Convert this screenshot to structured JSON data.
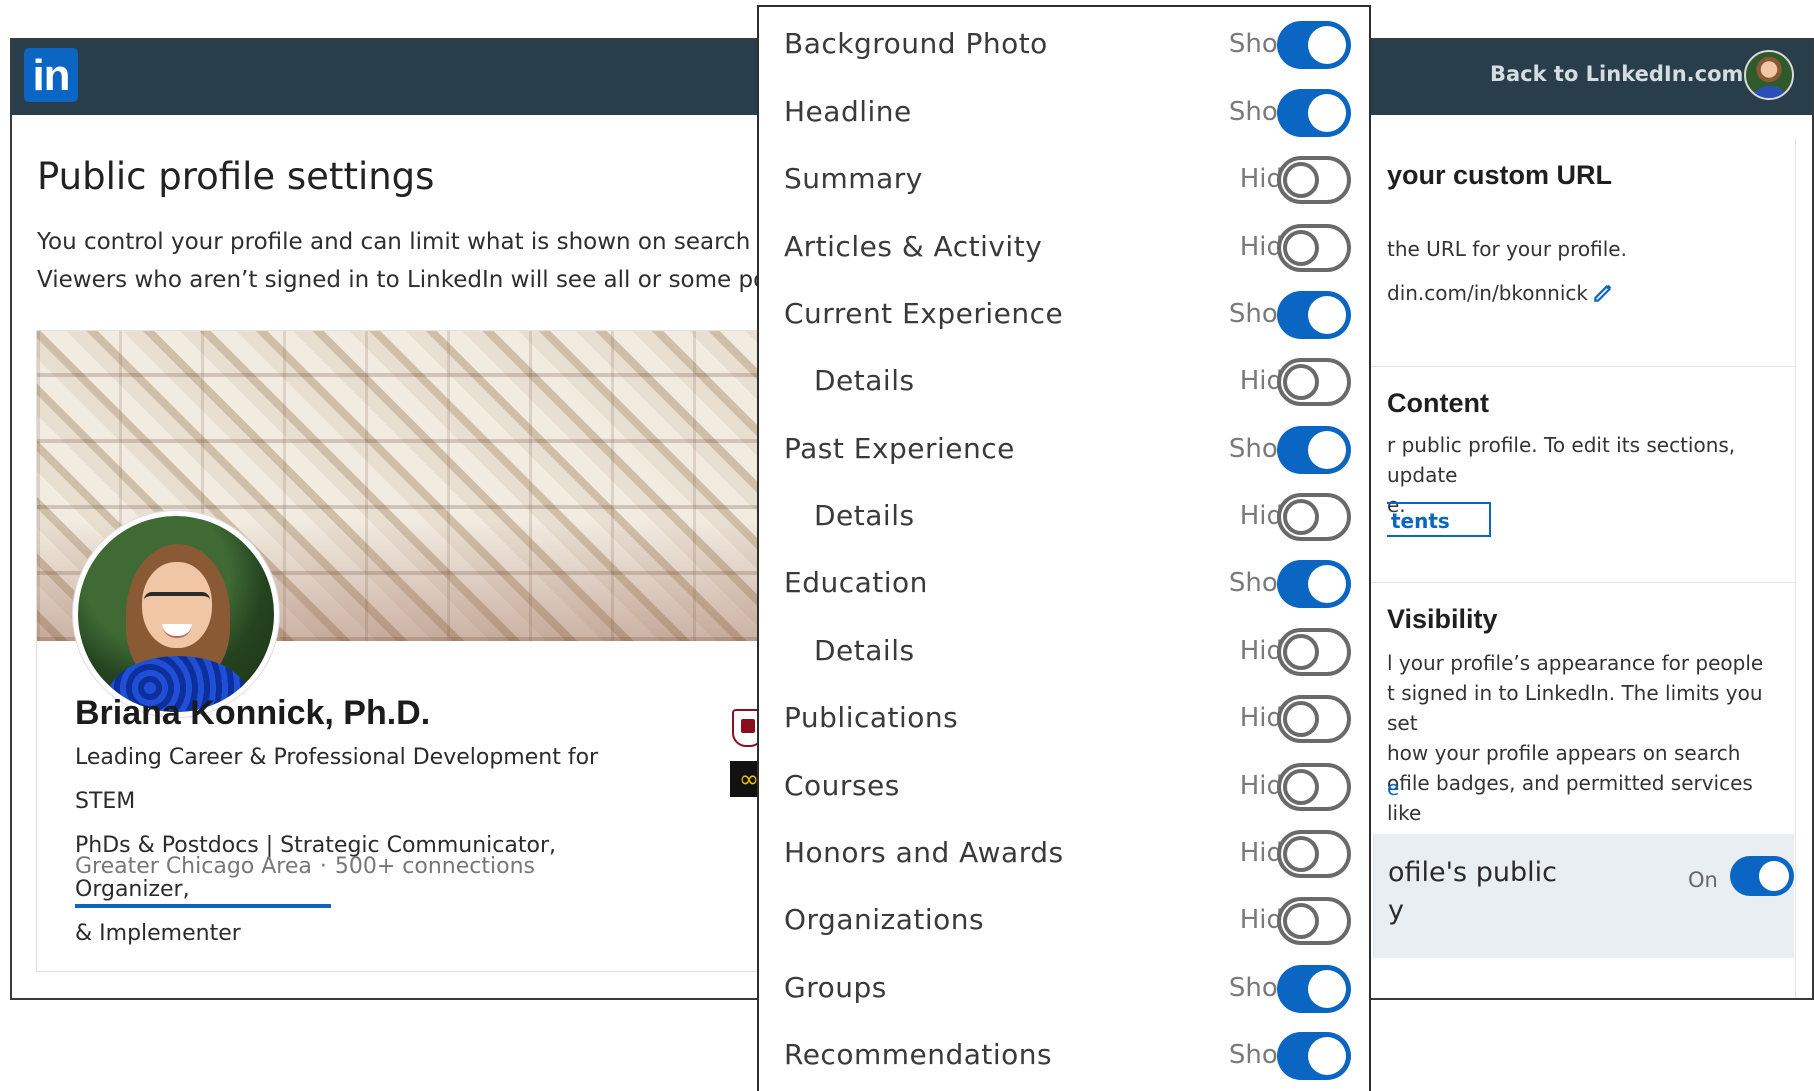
{
  "header": {
    "logo_text": "in",
    "back_link": "Back to LinkedIn.com"
  },
  "page": {
    "title": "Public profile settings",
    "intro_line1": "You control your profile and can limit what is shown on search en",
    "intro_line2": "Viewers who aren’t signed in to LinkedIn will see all or some porti"
  },
  "profile": {
    "name": "Briana Konnick, Ph.D.",
    "headline_line1": "Leading Career & Professional Development for STEM",
    "headline_line2": "PhDs & Postdocs | Strategic Communicator, Organizer,",
    "headline_line3": "& Implementer",
    "location": "Greater Chicago Area",
    "separator": "·",
    "connections": "500+ connections",
    "side_badge_symbol": "∞"
  },
  "right_panel": {
    "custom_url_title": "your custom URL",
    "custom_url_desc": "the URL for your profile.",
    "custom_url_value": "din.com/in/bkonnick",
    "content_title": "Content",
    "content_desc_line1": "r public profile. To edit its sections, update",
    "content_desc_line2": "e.",
    "contents_button": "tents",
    "visibility_title": "Visibility",
    "visibility_desc_line1": "l your profile’s appearance for people",
    "visibility_desc_line2": "t signed in to LinkedIn. The limits you set",
    "visibility_desc_line3": "how your profile appears on search",
    "visibility_desc_line4": "ofile badges, and permitted services like",
    "visibility_link": "e",
    "public_box_line1": "ofile's public",
    "public_box_line2": "y",
    "public_state": "On"
  },
  "visibility_items": [
    {
      "label": "Background Photo",
      "state": "Show",
      "indent": false
    },
    {
      "label": "Headline",
      "state": "Show",
      "indent": false
    },
    {
      "label": "Summary",
      "state": "Hide",
      "indent": false
    },
    {
      "label": "Articles & Activity",
      "state": "Hide",
      "indent": false
    },
    {
      "label": "Current Experience",
      "state": "Show",
      "indent": false
    },
    {
      "label": "Details",
      "state": "Hide",
      "indent": true
    },
    {
      "label": "Past Experience",
      "state": "Show",
      "indent": false
    },
    {
      "label": "Details",
      "state": "Hide",
      "indent": true
    },
    {
      "label": "Education",
      "state": "Show",
      "indent": false
    },
    {
      "label": "Details",
      "state": "Hide",
      "indent": true
    },
    {
      "label": "Publications",
      "state": "Hide",
      "indent": false
    },
    {
      "label": "Courses",
      "state": "Hide",
      "indent": false
    },
    {
      "label": "Honors and Awards",
      "state": "Hide",
      "indent": false
    },
    {
      "label": "Organizations",
      "state": "Hide",
      "indent": false
    },
    {
      "label": "Groups",
      "state": "Show",
      "indent": false
    },
    {
      "label": "Recommendations",
      "state": "Show",
      "indent": false
    }
  ],
  "colors": {
    "header_bg": "#283e4a",
    "accent_blue": "#0a66c2",
    "toggle_off": "#6a6a6a"
  },
  "icons": {
    "logo": "linkedin-logo-icon",
    "edit": "pencil-icon",
    "avatar": "user-avatar"
  }
}
